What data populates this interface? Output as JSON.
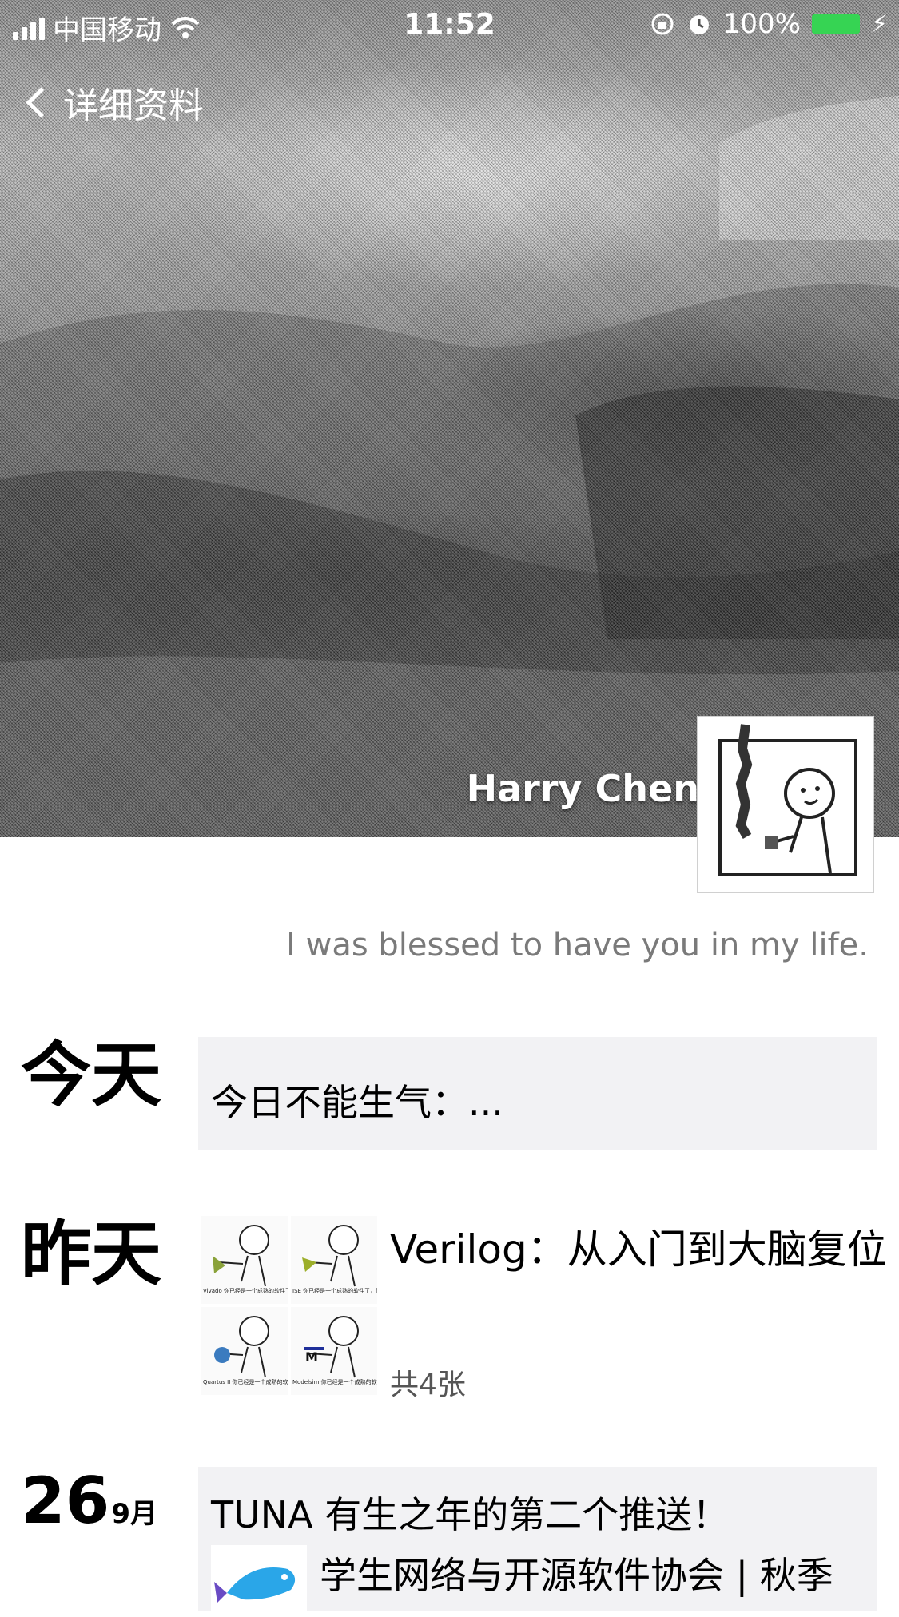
{
  "status_bar": {
    "carrier": "中国移动",
    "time": "11:52",
    "battery": "100%",
    "icons": [
      "signal-icon",
      "wifi-icon",
      "lock-rotation-icon",
      "alarm-icon",
      "battery-icon",
      "charging-icon"
    ]
  },
  "nav": {
    "back_label": "详细资料"
  },
  "profile": {
    "name": "Harry Chen",
    "signature": "I was blessed to have you in my life."
  },
  "timeline": [
    {
      "day_label": "今天",
      "text": "今日不能生气：..."
    },
    {
      "day_label": "昨天",
      "title": "Verilog：从入门到大脑复位",
      "count": "共4张",
      "thumbs": [
        {
          "caption": "Vivado 你已经是一个成熟的软件了，该学会自己布线了！！！"
        },
        {
          "caption": "ISE 你已经是一个成熟的软件了，该学会自己编译了！！！"
        },
        {
          "caption": "Quartus II 你已经是一个成熟的软件了，该学会自己综合了！！！"
        },
        {
          "caption": "Modelsim 你已经是一个成熟的软件了，该学会自己仿真了！！！"
        }
      ]
    },
    {
      "day_num": "26",
      "month": "9月",
      "title": "TUNA 有生之年的第二个推送！",
      "subtitle": "学生网络与开源软件协会 | 秋季"
    }
  ],
  "colors": {
    "battery": "#36d453",
    "card_bg": "#f2f2f4",
    "signature": "#7a7a7a"
  }
}
